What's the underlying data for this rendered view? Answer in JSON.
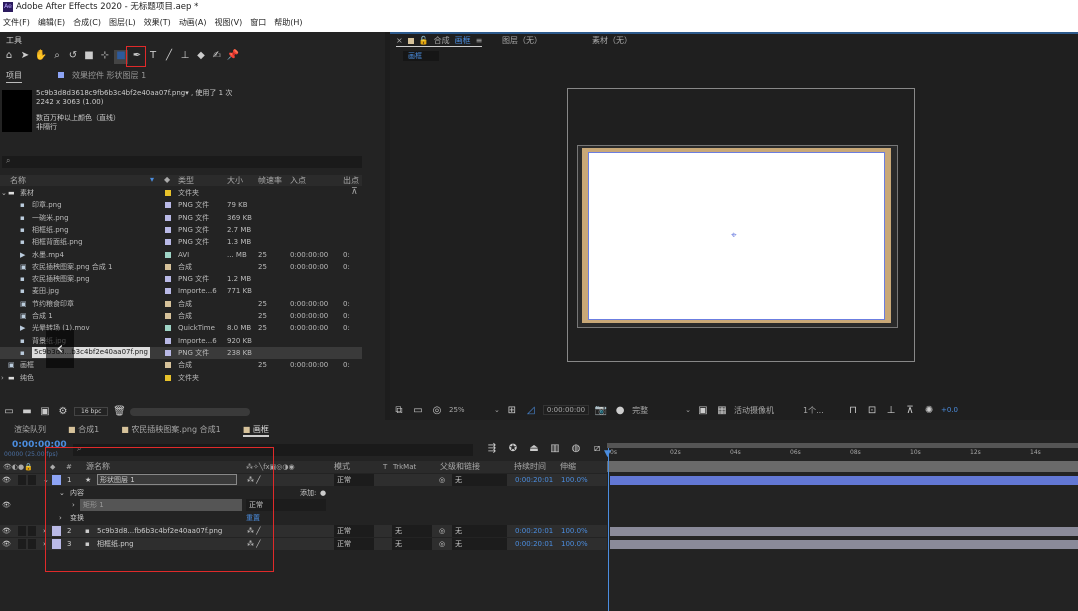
{
  "window": {
    "title": "Adobe After Effects 2020 - 无标题项目.aep *",
    "app_icon": "Ae"
  },
  "menu": [
    "文件(F)",
    "编辑(E)",
    "合成(C)",
    "图层(L)",
    "效果(T)",
    "动画(A)",
    "视图(V)",
    "窗口",
    "帮助(H)"
  ],
  "tools": {
    "label": "工具",
    "icons": [
      "home-icon",
      "selection-arrow-icon",
      "hand-icon",
      "zoom-icon",
      "rotate-icon",
      "camera-icon",
      "pan-behind-icon",
      "rectangle-tool-icon",
      "pen-icon",
      "type-icon",
      "brush-icon",
      "clone-stamp-icon",
      "eraser-icon",
      "roto-brush-icon",
      "puppet-pin-icon"
    ],
    "selected": "rectangle-tool-icon"
  },
  "project": {
    "tab": "项目",
    "effects_tab": "效果控件 形状图层 1",
    "info": {
      "filename": "5c9b3d8d3618c9fb6b3c4bf2e40aa07f.png▾ , 使用了 1 次",
      "dims": "2242 x 3063 (1.00)",
      "color": "数百万种以上颜色（直线）",
      "interlace": "非隔行"
    },
    "search_placeholder": "",
    "columns": [
      "名称",
      "类型",
      "大小",
      "帧速率",
      "入点",
      "出点"
    ],
    "items": [
      {
        "name": "素材",
        "type": "文件夹",
        "size": "",
        "fps": "",
        "in": "",
        "out": "",
        "kind": "folder",
        "color": "#e8c22a",
        "indent": 0,
        "open": true
      },
      {
        "name": "印章.png",
        "type": "PNG 文件",
        "size": "79 KB",
        "fps": "",
        "in": "",
        "out": "",
        "kind": "file",
        "color": "#b9b9e6",
        "indent": 1
      },
      {
        "name": "一碗米.png",
        "type": "PNG 文件",
        "size": "369 KB",
        "fps": "",
        "in": "",
        "out": "",
        "kind": "file",
        "color": "#b9b9e6",
        "indent": 1
      },
      {
        "name": "相框纸.png",
        "type": "PNG 文件",
        "size": "2.7 MB",
        "fps": "",
        "in": "",
        "out": "",
        "kind": "file",
        "color": "#b9b9e6",
        "indent": 1
      },
      {
        "name": "相框背面纸.png",
        "type": "PNG 文件",
        "size": "1.3 MB",
        "fps": "",
        "in": "",
        "out": "",
        "kind": "file",
        "color": "#b9b9e6",
        "indent": 1
      },
      {
        "name": "水墨.mp4",
        "type": "AVI",
        "size": "... MB",
        "fps": "25",
        "in": "0:00:00:00",
        "out": "0:",
        "kind": "video",
        "color": "#9fd4c6",
        "indent": 1
      },
      {
        "name": "农民插秧图案.png 合成 1",
        "type": "合成",
        "size": "",
        "fps": "25",
        "in": "0:00:00:00",
        "out": "0:",
        "kind": "comp",
        "color": "#d6c29a",
        "indent": 1
      },
      {
        "name": "农民插秧图案.png",
        "type": "PNG 文件",
        "size": "1.2 MB",
        "fps": "",
        "in": "",
        "out": "",
        "kind": "file",
        "color": "#b9b9e6",
        "indent": 1
      },
      {
        "name": "麦田.jpg",
        "type": "Importe...6",
        "size": "771 KB",
        "fps": "",
        "in": "",
        "out": "",
        "kind": "file",
        "color": "#b9b9e6",
        "indent": 1
      },
      {
        "name": "节约粮食印章",
        "type": "合成",
        "size": "",
        "fps": "25",
        "in": "0:00:00:00",
        "out": "0:",
        "kind": "comp",
        "color": "#d6c29a",
        "indent": 1
      },
      {
        "name": "合成 1",
        "type": "合成",
        "size": "",
        "fps": "25",
        "in": "0:00:00:00",
        "out": "0:",
        "kind": "comp",
        "color": "#d6c29a",
        "indent": 1
      },
      {
        "name": "光晕转场 (1).mov",
        "type": "QuickTime",
        "size": "8.0 MB",
        "fps": "25",
        "in": "0:00:00:00",
        "out": "0:",
        "kind": "video",
        "color": "#9fd4c6",
        "indent": 1
      },
      {
        "name": "背景纸.jpg",
        "type": "Importe...6",
        "size": "920 KB",
        "fps": "",
        "in": "",
        "out": "",
        "kind": "file",
        "color": "#b9b9e6",
        "indent": 1
      },
      {
        "name": "5c9b3d8...b3c4bf2e40aa07f.png",
        "type": "PNG 文件",
        "size": "238 KB",
        "fps": "",
        "in": "",
        "out": "",
        "kind": "file",
        "color": "#b9b9e6",
        "indent": 1,
        "selected": true
      },
      {
        "name": "画框",
        "type": "合成",
        "size": "",
        "fps": "25",
        "in": "0:00:00:00",
        "out": "0:",
        "kind": "comp",
        "color": "#d6c29a",
        "indent": 0
      },
      {
        "name": "纯色",
        "type": "文件夹",
        "size": "",
        "fps": "",
        "in": "",
        "out": "",
        "kind": "folder",
        "color": "#e8c22a",
        "indent": 0,
        "open": false
      }
    ],
    "bpc": "16 bpc"
  },
  "viewer": {
    "tab": "合成",
    "comp_name": "画框",
    "layer_tab": "图层（无）",
    "footage_tab": "素材（无）",
    "subtab": "画框",
    "toolbar": {
      "zoom": "25%",
      "timecode": "0:00:00:00",
      "resolution": "完整",
      "camera": "活动摄像机",
      "views": "1个...",
      "exposure": "+0.0"
    }
  },
  "timeline": {
    "tabs": [
      "渲染队列",
      "合成1",
      "农民插秧图案.png 合成1",
      "画框"
    ],
    "active_tab": "画框",
    "timecode": "0:00:00:00",
    "fps_label": "00000 (25.00 fps)",
    "columns": {
      "num": "#",
      "source": "源名称",
      "mode": "模式",
      "trkmat_t": "T",
      "trkmat": "TrkMat",
      "parent": "父级和链接",
      "duration": "持续时间",
      "stretch": "伸缩"
    },
    "layers": [
      {
        "num": "1",
        "name": "形状图层 1",
        "mode": "正常",
        "trkmat": "",
        "parent": "无",
        "duration": "0:00:20:01",
        "stretch": "100.0%",
        "color": "#8da4f5",
        "kind": "shape"
      },
      {
        "num": "2",
        "name": "5c9b3d8...fb6b3c4bf2e40aa07f.png",
        "mode": "正常",
        "trkmat": "无",
        "parent": "无",
        "duration": "0:00:20:01",
        "stretch": "100.0%",
        "color": "#b9b9e6",
        "kind": "file"
      },
      {
        "num": "3",
        "name": "相框纸.png",
        "mode": "正常",
        "trkmat": "无",
        "parent": "无",
        "duration": "0:00:20:01",
        "stretch": "100.0%",
        "color": "#b9b9e6",
        "kind": "file"
      }
    ],
    "contents_label": "内容",
    "add_label": "添加:",
    "rect_label": "矩形 1",
    "rect_mode": "正常",
    "transform_label": "变换",
    "reset_label": "重置",
    "ruler": [
      "0s",
      "02s",
      "04s",
      "06s",
      "08s",
      "10s",
      "12s",
      "14s"
    ],
    "accent": "#4b8ddf",
    "highlight": "#e02a2a"
  }
}
